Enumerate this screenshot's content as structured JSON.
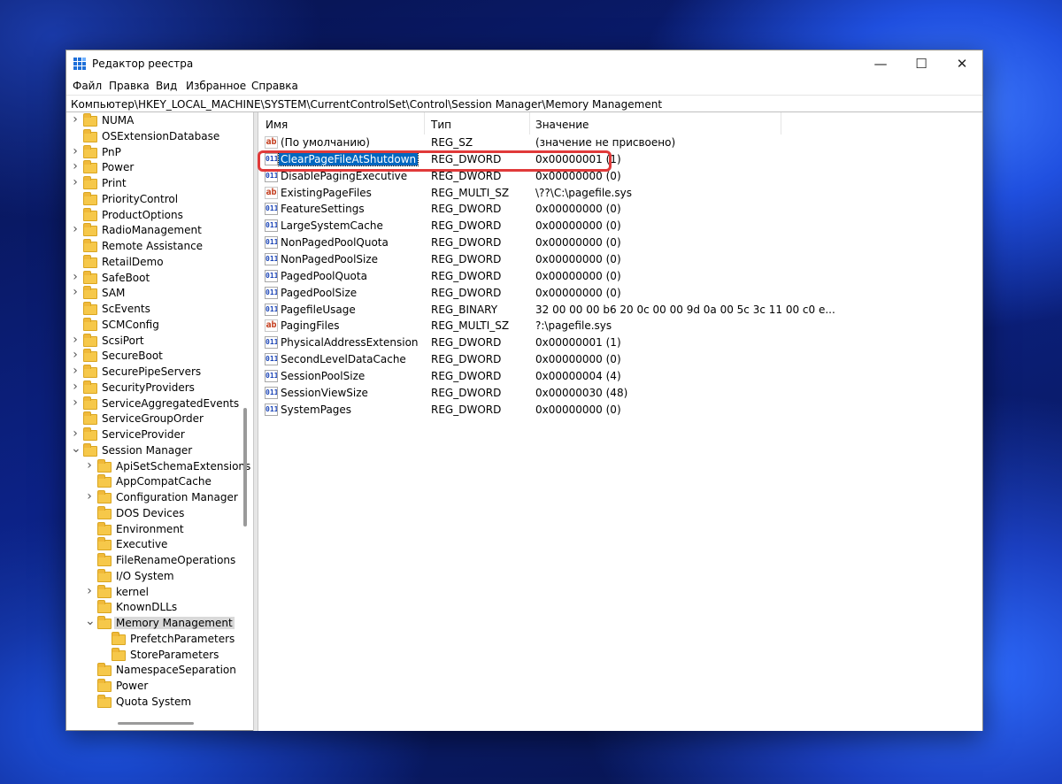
{
  "window": {
    "title": "Редактор реестра",
    "controls": {
      "minimize": "—",
      "maximize": "☐",
      "close": "✕"
    }
  },
  "menu": [
    "Файл",
    "Правка",
    "Вид",
    "Избранное",
    "Справка"
  ],
  "address": "Компьютер\\HKEY_LOCAL_MACHINE\\SYSTEM\\CurrentControlSet\\Control\\Session Manager\\Memory Management",
  "tree": [
    {
      "label": "NUMA",
      "level": 0,
      "expander": "collapsed"
    },
    {
      "label": "OSExtensionDatabase",
      "level": 0,
      "expander": "none"
    },
    {
      "label": "PnP",
      "level": 0,
      "expander": "collapsed"
    },
    {
      "label": "Power",
      "level": 0,
      "expander": "collapsed"
    },
    {
      "label": "Print",
      "level": 0,
      "expander": "collapsed"
    },
    {
      "label": "PriorityControl",
      "level": 0,
      "expander": "none"
    },
    {
      "label": "ProductOptions",
      "level": 0,
      "expander": "none"
    },
    {
      "label": "RadioManagement",
      "level": 0,
      "expander": "collapsed"
    },
    {
      "label": "Remote Assistance",
      "level": 0,
      "expander": "none"
    },
    {
      "label": "RetailDemo",
      "level": 0,
      "expander": "none"
    },
    {
      "label": "SafeBoot",
      "level": 0,
      "expander": "collapsed"
    },
    {
      "label": "SAM",
      "level": 0,
      "expander": "collapsed"
    },
    {
      "label": "ScEvents",
      "level": 0,
      "expander": "none"
    },
    {
      "label": "SCMConfig",
      "level": 0,
      "expander": "none"
    },
    {
      "label": "ScsiPort",
      "level": 0,
      "expander": "collapsed"
    },
    {
      "label": "SecureBoot",
      "level": 0,
      "expander": "collapsed"
    },
    {
      "label": "SecurePipeServers",
      "level": 0,
      "expander": "collapsed"
    },
    {
      "label": "SecurityProviders",
      "level": 0,
      "expander": "collapsed"
    },
    {
      "label": "ServiceAggregatedEvents",
      "level": 0,
      "expander": "collapsed"
    },
    {
      "label": "ServiceGroupOrder",
      "level": 0,
      "expander": "none"
    },
    {
      "label": "ServiceProvider",
      "level": 0,
      "expander": "collapsed"
    },
    {
      "label": "Session Manager",
      "level": 0,
      "expander": "expanded"
    },
    {
      "label": "ApiSetSchemaExtensions",
      "level": 1,
      "expander": "collapsed"
    },
    {
      "label": "AppCompatCache",
      "level": 1,
      "expander": "none"
    },
    {
      "label": "Configuration Manager",
      "level": 1,
      "expander": "collapsed"
    },
    {
      "label": "DOS Devices",
      "level": 1,
      "expander": "none"
    },
    {
      "label": "Environment",
      "level": 1,
      "expander": "none"
    },
    {
      "label": "Executive",
      "level": 1,
      "expander": "none"
    },
    {
      "label": "FileRenameOperations",
      "level": 1,
      "expander": "none"
    },
    {
      "label": "I/O System",
      "level": 1,
      "expander": "none"
    },
    {
      "label": "kernel",
      "level": 1,
      "expander": "collapsed"
    },
    {
      "label": "KnownDLLs",
      "level": 1,
      "expander": "none"
    },
    {
      "label": "Memory Management",
      "level": 1,
      "expander": "expanded",
      "selected": true
    },
    {
      "label": "PrefetchParameters",
      "level": 2,
      "expander": "none"
    },
    {
      "label": "StoreParameters",
      "level": 2,
      "expander": "none"
    },
    {
      "label": "NamespaceSeparation",
      "level": 1,
      "expander": "none"
    },
    {
      "label": "Power",
      "level": 1,
      "expander": "none"
    },
    {
      "label": "Quota System",
      "level": 1,
      "expander": "none"
    }
  ],
  "columns": {
    "name": "Имя",
    "type": "Тип",
    "data": "Значение"
  },
  "values": [
    {
      "icon": "string",
      "name": "(По умолчанию)",
      "type": "REG_SZ",
      "data": "(значение не присвоено)"
    },
    {
      "icon": "binary",
      "name": "ClearPageFileAtShutdown",
      "type": "REG_DWORD",
      "data": "0x00000001 (1)",
      "selected": true
    },
    {
      "icon": "binary",
      "name": "DisablePagingExecutive",
      "type": "REG_DWORD",
      "data": "0x00000000 (0)"
    },
    {
      "icon": "string",
      "name": "ExistingPageFiles",
      "type": "REG_MULTI_SZ",
      "data": "\\??\\C:\\pagefile.sys"
    },
    {
      "icon": "binary",
      "name": "FeatureSettings",
      "type": "REG_DWORD",
      "data": "0x00000000 (0)"
    },
    {
      "icon": "binary",
      "name": "LargeSystemCache",
      "type": "REG_DWORD",
      "data": "0x00000000 (0)"
    },
    {
      "icon": "binary",
      "name": "NonPagedPoolQuota",
      "type": "REG_DWORD",
      "data": "0x00000000 (0)"
    },
    {
      "icon": "binary",
      "name": "NonPagedPoolSize",
      "type": "REG_DWORD",
      "data": "0x00000000 (0)"
    },
    {
      "icon": "binary",
      "name": "PagedPoolQuota",
      "type": "REG_DWORD",
      "data": "0x00000000 (0)"
    },
    {
      "icon": "binary",
      "name": "PagedPoolSize",
      "type": "REG_DWORD",
      "data": "0x00000000 (0)"
    },
    {
      "icon": "binary",
      "name": "PagefileUsage",
      "type": "REG_BINARY",
      "data": "32 00 00 00 b6 20 0c 00 00 9d 0a 00 5c 3c 11 00 c0 e..."
    },
    {
      "icon": "string",
      "name": "PagingFiles",
      "type": "REG_MULTI_SZ",
      "data": "?:\\pagefile.sys"
    },
    {
      "icon": "binary",
      "name": "PhysicalAddressExtension",
      "type": "REG_DWORD",
      "data": "0x00000001 (1)"
    },
    {
      "icon": "binary",
      "name": "SecondLevelDataCache",
      "type": "REG_DWORD",
      "data": "0x00000000 (0)"
    },
    {
      "icon": "binary",
      "name": "SessionPoolSize",
      "type": "REG_DWORD",
      "data": "0x00000004 (4)"
    },
    {
      "icon": "binary",
      "name": "SessionViewSize",
      "type": "REG_DWORD",
      "data": "0x00000030 (48)"
    },
    {
      "icon": "binary",
      "name": "SystemPages",
      "type": "REG_DWORD",
      "data": "0x00000000 (0)"
    }
  ],
  "icon_glyphs": {
    "string": "ab",
    "binary": "011"
  },
  "colors": {
    "selection": "#0067c0",
    "highlight_box": "#e03a3a",
    "folder": "#f6c84a"
  }
}
